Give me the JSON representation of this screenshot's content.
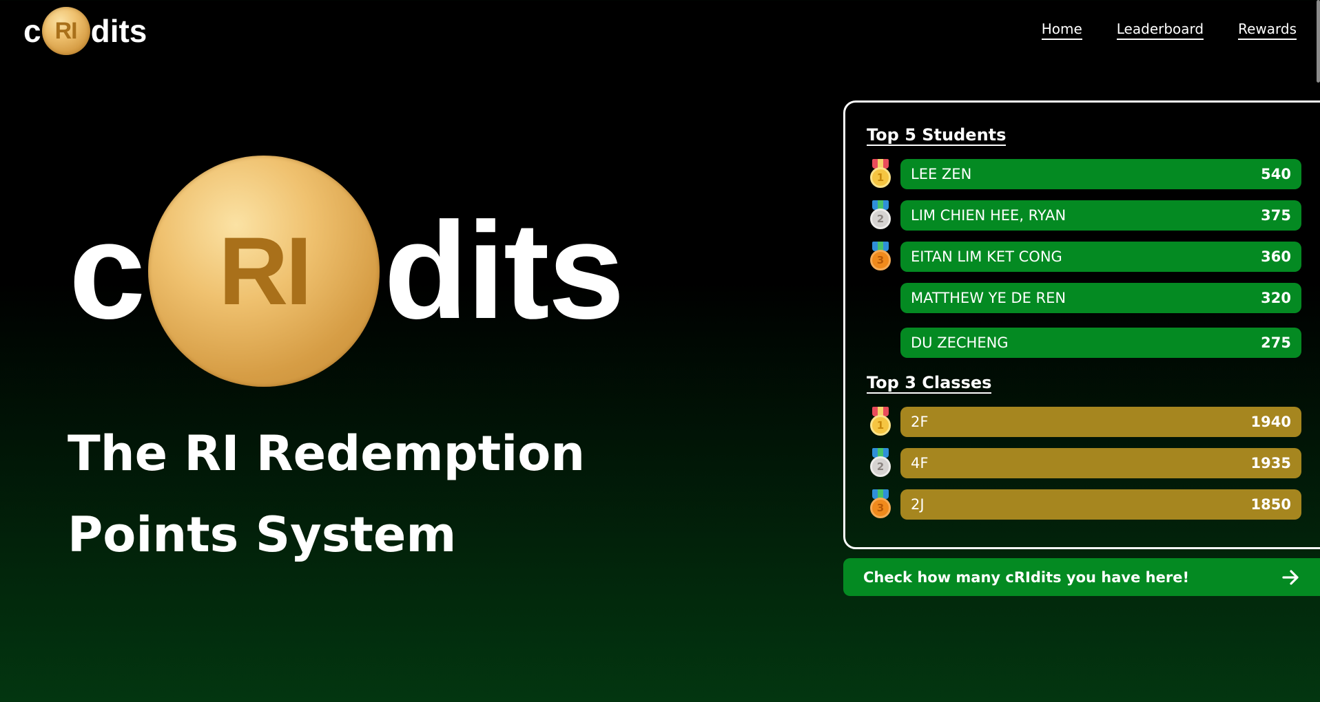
{
  "brand": {
    "prefix": "c",
    "coin_text": "RI",
    "suffix": "dits"
  },
  "nav": {
    "items": [
      {
        "label": "Home"
      },
      {
        "label": "Leaderboard"
      },
      {
        "label": "Rewards"
      }
    ]
  },
  "hero": {
    "logo_prefix": "c",
    "logo_coin_text": "RI",
    "logo_suffix": "dits",
    "title_line1": "The RI Redemption",
    "title_line2": "Points System"
  },
  "leaderboard": {
    "students_heading": "Top 5 Students",
    "students": [
      {
        "rank": "1",
        "name": "LEE ZEN",
        "points": "540",
        "medal": "gold-medal-icon"
      },
      {
        "rank": "2",
        "name": "LIM CHIEN HEE, RYAN",
        "points": "375",
        "medal": "silver-medal-icon"
      },
      {
        "rank": "3",
        "name": "EITAN LIM KET CONG",
        "points": "360",
        "medal": "bronze-medal-icon"
      },
      {
        "name": "MATTHEW YE DE REN",
        "points": "320"
      },
      {
        "name": "DU ZECHENG",
        "points": "275"
      }
    ],
    "classes_heading": "Top 3 Classes",
    "classes": [
      {
        "rank": "1",
        "name": "2F",
        "points": "1940",
        "medal": "gold-medal-icon"
      },
      {
        "rank": "2",
        "name": "4F",
        "points": "1935",
        "medal": "silver-medal-icon"
      },
      {
        "rank": "3",
        "name": "2J",
        "points": "1850",
        "medal": "bronze-medal-icon"
      }
    ]
  },
  "cta": {
    "label": "Check how many cRIdits you have here!",
    "icon": "arrow-right-icon"
  },
  "colors": {
    "student_row": "#048a22",
    "class_row": "#a6861f",
    "cta": "#048a22",
    "coin_gold": "#e8b865",
    "gold_medal": "#f5c542",
    "silver_medal": "#d6d3d1",
    "bronze_medal": "#f08a1c"
  }
}
